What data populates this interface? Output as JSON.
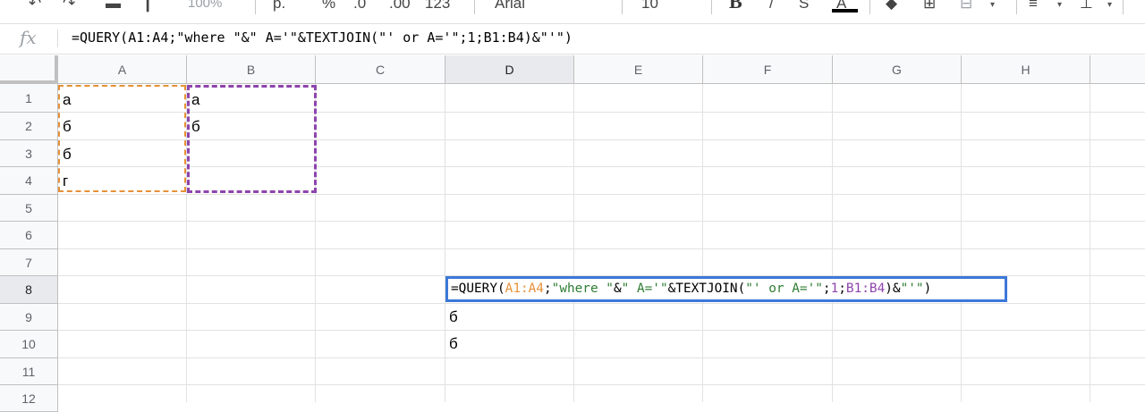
{
  "toolbar": {
    "zoom_label": "100%",
    "currency_label": "р.",
    "percent_label": "%",
    "decrease_decimal_label": ".0",
    "increase_decimal_label": ".00",
    "format_label": "123",
    "font_name": "Arial",
    "font_size": "10",
    "bold_label": "B",
    "text_color_label": "A"
  },
  "formula_bar": {
    "fx_label": "fx",
    "formula": "=QUERY(A1:A4;\"where \"&\" A='\"&TEXTJOIN(\"' or A='\";1;B1:B4)&\"'\")"
  },
  "columns": [
    "A",
    "B",
    "C",
    "D",
    "E",
    "F",
    "G",
    "H"
  ],
  "rows": [
    "1",
    "2",
    "3",
    "4",
    "5",
    "6",
    "7",
    "8",
    "9",
    "10",
    "11",
    "12"
  ],
  "cells": {
    "A1": "а",
    "A2": "б",
    "A3": "б",
    "A4": "г",
    "B1": "а",
    "B2": "б",
    "D9": "б",
    "D10": "б"
  },
  "edit_formula": {
    "p1": "=QUERY(",
    "p2": "A1:A4",
    "p3": ";",
    "p4": "\"where \"",
    "p5": "&",
    "p6": "\" A='\"",
    "p7": "&TEXTJOIN(",
    "p8": "\"' or A='\"",
    "p9": ";",
    "p10": "1",
    "p11": ";",
    "p12": "B1:B4",
    "p13": ")&",
    "p14": "\"'\"",
    "p15": ")"
  },
  "colors": {
    "range_a": "#e69138",
    "range_b": "#8e44ad",
    "string": "#2e7d32",
    "edit_border": "#3c78d8"
  }
}
